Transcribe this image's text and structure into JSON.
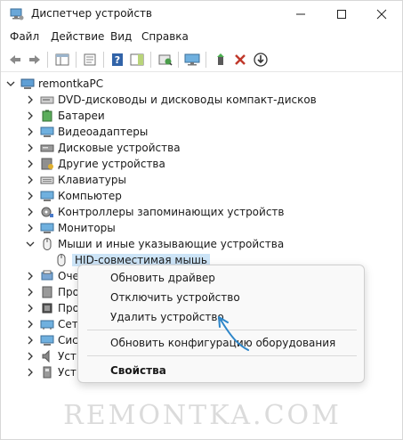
{
  "window": {
    "title": "Диспетчер устройств"
  },
  "menu": {
    "file": "Файл",
    "action": "Действие",
    "view": "Вид",
    "help": "Справка"
  },
  "tree": {
    "root": "remontkaPC",
    "categories": [
      "DVD-дисководы и дисководы компакт-дисков",
      "Батареи",
      "Видеоадаптеры",
      "Дисковые устройства",
      "Другие устройства",
      "Клавиатуры",
      "Компьютер",
      "Контроллеры запоминающих устройств",
      "Мониторы",
      "Мыши и иные указывающие устройства"
    ],
    "selected_device": "HID-совместимая мышь",
    "truncated": [
      "Оче",
      "Про",
      "Про",
      "Сет",
      "Сис",
      "Уст",
      "Уст"
    ]
  },
  "context_menu": {
    "update_driver": "Обновить драйвер",
    "disable_device": "Отключить устройство",
    "uninstall_device": "Удалить устройство",
    "scan_hardware": "Обновить конфигурацию оборудования",
    "properties": "Свойства"
  },
  "watermark": "REMONTKA.COM",
  "colors": {
    "selection": "#cce4f7",
    "arrow": "#2e86c9",
    "remove_x": "#c0392b"
  }
}
